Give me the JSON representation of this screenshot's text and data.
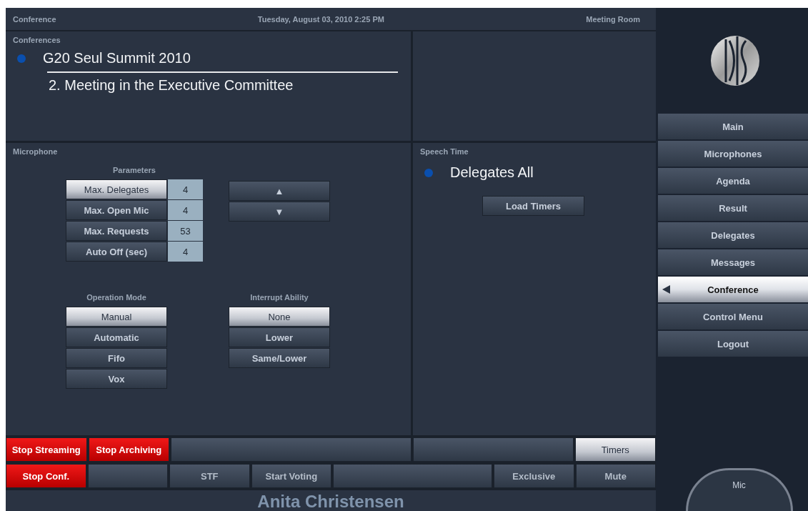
{
  "header": {
    "title": "Conference",
    "datetime": "Tuesday, August 03, 2010 2:25 PM",
    "room": "Meeting Room"
  },
  "conferences": {
    "heading": "Conferences",
    "name": "G20 Seul Summit 2010",
    "meeting": "2. Meeting in the Executive Committee"
  },
  "microphone": {
    "heading": "Microphone",
    "parameters_heading": "Parameters",
    "parameters": [
      {
        "label": "Max. Delegates",
        "value": "4",
        "selected": true
      },
      {
        "label": "Max. Open Mic",
        "value": "4",
        "selected": false
      },
      {
        "label": "Max. Requests",
        "value": "53",
        "selected": false
      },
      {
        "label": "Auto Off (sec)",
        "value": "4",
        "selected": false
      }
    ],
    "arrows": [
      "▲",
      "▼"
    ],
    "operation_mode_heading": "Operation Mode",
    "operation_modes": [
      {
        "label": "Manual",
        "selected": true
      },
      {
        "label": "Automatic",
        "selected": false
      },
      {
        "label": "Fifo",
        "selected": false
      },
      {
        "label": "Vox",
        "selected": false
      }
    ],
    "interrupt_heading": "Interrupt Ability",
    "interrupt_options": [
      {
        "label": "None",
        "selected": true
      },
      {
        "label": "Lower",
        "selected": false
      },
      {
        "label": "Same/Lower",
        "selected": false
      }
    ]
  },
  "speech_time": {
    "heading": "Speech Time",
    "group": "Delegates All",
    "button": "Load Timers"
  },
  "bottom_row_1": [
    {
      "kind": "alert",
      "label": "Stop Streaming"
    },
    {
      "kind": "alert",
      "label": "Stop Archiving"
    },
    {
      "kind": "blank"
    },
    {
      "kind": "blank"
    },
    {
      "kind": "toggle",
      "label": "Timers",
      "selected": true
    }
  ],
  "bottom_row_2": [
    {
      "kind": "alert",
      "label": "Stop Conf."
    },
    {
      "kind": "blank"
    },
    {
      "kind": "normal",
      "label": "STF"
    },
    {
      "kind": "normal",
      "label": "Start Voting"
    },
    {
      "kind": "blank"
    },
    {
      "kind": "normal",
      "label": "Exclusive"
    },
    {
      "kind": "normal",
      "label": "Mute"
    }
  ],
  "user_name": "Anita Christensen",
  "menu": [
    {
      "label": "Main",
      "selected": false
    },
    {
      "label": "Microphones",
      "selected": false
    },
    {
      "label": "Agenda",
      "selected": false
    },
    {
      "label": "Result",
      "selected": false
    },
    {
      "label": "Delegates",
      "selected": false
    },
    {
      "label": "Messages",
      "selected": false
    },
    {
      "label": "Conference",
      "selected": true
    },
    {
      "label": "Control Menu",
      "selected": false
    },
    {
      "label": "Logout",
      "selected": false
    }
  ],
  "mic_button": "Mic"
}
